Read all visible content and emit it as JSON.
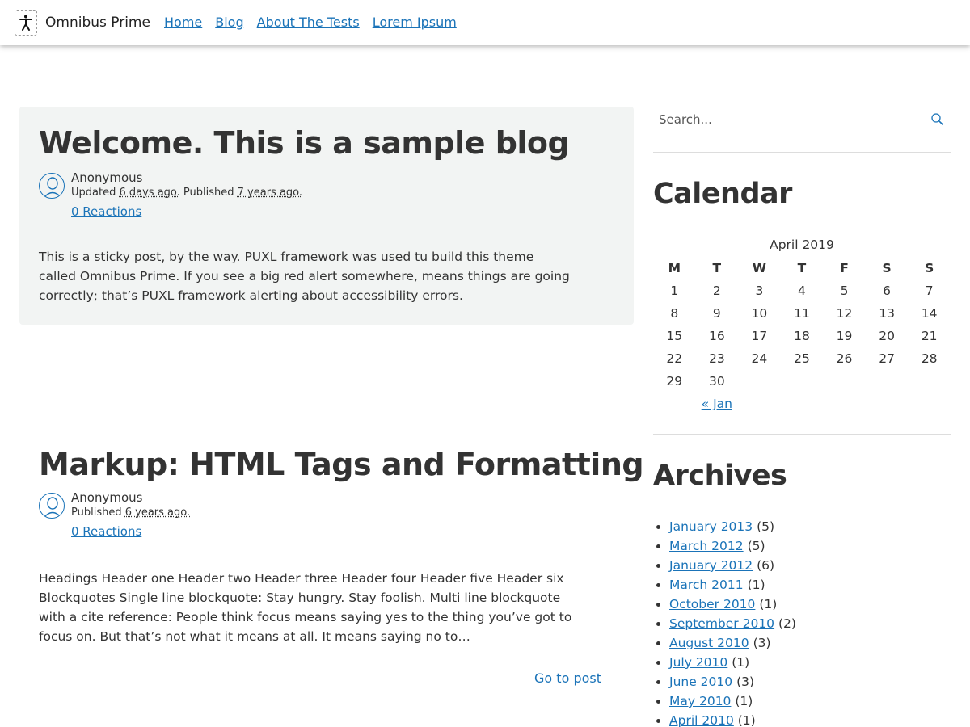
{
  "site": {
    "title": "Omnibus Prime"
  },
  "nav": [
    "Home",
    "Blog",
    "About The Tests",
    "Lorem Ipsum"
  ],
  "posts": [
    {
      "title": "Welcome. This is a sample blog",
      "author": "Anonymous",
      "updated_label": "Updated",
      "updated": "6 days ago.",
      "published_label": "Published",
      "published": "7 years ago.",
      "reactions": "0 Reactions",
      "excerpt": "This is a sticky post, by the way. PUXL framework was used tu build this theme called Omnibus Prime. If you see a big red alert somewhere, means things are going correctly; that’s PUXL framework alerting about accessibility errors."
    },
    {
      "title": "Markup: HTML Tags and Formatting",
      "author": "Anonymous",
      "published_label": "Published",
      "published": "6 years ago.",
      "reactions": "0 Reactions",
      "excerpt": "Headings Header one Header two Header three Header four Header five Header six Blockquotes Single line blockquote: Stay hungry. Stay foolish. Multi line blockquote with a cite reference: People think focus means saying yes to the thing you’ve got to focus on. But that’s not what it means at all. It means saying no to…",
      "go_to_post": "Go to post"
    }
  ],
  "search": {
    "placeholder": "Search..."
  },
  "calendar": {
    "title": "Calendar",
    "caption": "April 2019",
    "weekdays": [
      "M",
      "T",
      "W",
      "T",
      "F",
      "S",
      "S"
    ],
    "weeks": [
      [
        "1",
        "2",
        "3",
        "4",
        "5",
        "6",
        "7"
      ],
      [
        "8",
        "9",
        "10",
        "11",
        "12",
        "13",
        "14"
      ],
      [
        "15",
        "16",
        "17",
        "18",
        "19",
        "20",
        "21"
      ],
      [
        "22",
        "23",
        "24",
        "25",
        "26",
        "27",
        "28"
      ],
      [
        "29",
        "30",
        "",
        "",
        "",
        "",
        ""
      ]
    ],
    "prev": "« Jan"
  },
  "archives": {
    "title": "Archives",
    "items": [
      {
        "label": "January 2013",
        "count": "(5)"
      },
      {
        "label": "March 2012",
        "count": "(5)"
      },
      {
        "label": "January 2012",
        "count": "(6)"
      },
      {
        "label": "March 2011",
        "count": "(1)"
      },
      {
        "label": "October 2010",
        "count": "(1)"
      },
      {
        "label": "September 2010",
        "count": "(2)"
      },
      {
        "label": "August 2010",
        "count": "(3)"
      },
      {
        "label": "July 2010",
        "count": "(1)"
      },
      {
        "label": "June 2010",
        "count": "(3)"
      },
      {
        "label": "May 2010",
        "count": "(1)"
      },
      {
        "label": "April 2010",
        "count": "(1)"
      }
    ]
  },
  "colors": {
    "link": "#1a73b8",
    "sticky_bg": "#f2f4f3",
    "text": "#333333"
  },
  "icons": {
    "logo": "accessibility-person-icon",
    "avatar": "user-avatar-icon",
    "search": "search-icon"
  }
}
